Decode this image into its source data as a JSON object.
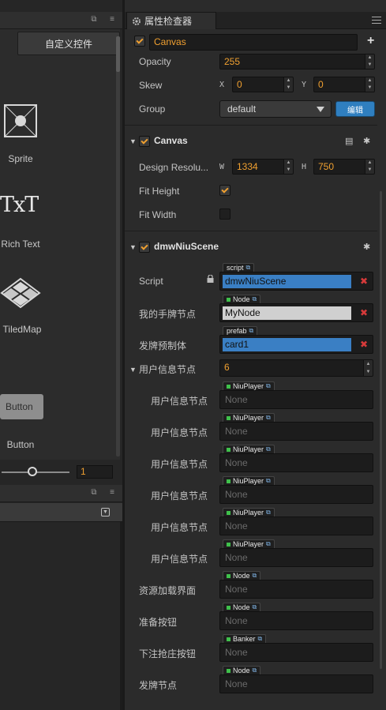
{
  "left_panel": {
    "custom_widgets_btn": "自定义控件",
    "widgets": [
      {
        "label": "Sprite",
        "icon": "sprite-icon"
      },
      {
        "label": "Rich Text",
        "icon": "richtext-icon"
      },
      {
        "label": "TiledMap",
        "icon": "tiledmap-icon"
      },
      {
        "label": "Button",
        "icon": "button-icon"
      }
    ],
    "richtext_glyph": "TxT",
    "button_preview_label": "Button",
    "zoom_value": "1",
    "zoom_level": 0.45
  },
  "inspector": {
    "tab_title": "属性检查器",
    "node": {
      "enabled": true,
      "name": "Canvas",
      "opacity_label": "Opacity",
      "opacity": "255",
      "skew_label": "Skew",
      "skew_x_axis": "X",
      "skew_x": "0",
      "skew_y_axis": "Y",
      "skew_y": "0",
      "group_label": "Group",
      "group_value": "default",
      "edit_button": "编辑"
    },
    "canvas_component": {
      "enabled": true,
      "title": "Canvas",
      "design_res_label": "Design Resolu...",
      "w_axis": "W",
      "width": "1334",
      "h_axis": "H",
      "height": "750",
      "fit_height_label": "Fit Height",
      "fit_height": true,
      "fit_width_label": "Fit Width",
      "fit_width": false
    },
    "script_component": {
      "enabled": true,
      "title": "dmwNiuScene",
      "fields": [
        {
          "label": "Script",
          "tag": "script",
          "value": "dmwNiuScene",
          "style": "blue"
        },
        {
          "label": "我的手牌节点",
          "tag": "Node",
          "value": "MyNode",
          "style": "grey"
        },
        {
          "label": "发牌预制体",
          "tag": "prefab",
          "value": "card1",
          "style": "blue"
        }
      ],
      "array_label": "用户信息节点",
      "array_size": "6",
      "array_items": [
        {
          "label": "用户信息节点",
          "tag": "NiuPlayer",
          "value": "None"
        },
        {
          "label": "用户信息节点",
          "tag": "NiuPlayer",
          "value": "None"
        },
        {
          "label": "用户信息节点",
          "tag": "NiuPlayer",
          "value": "None"
        },
        {
          "label": "用户信息节点",
          "tag": "NiuPlayer",
          "value": "None"
        },
        {
          "label": "用户信息节点",
          "tag": "NiuPlayer",
          "value": "None"
        },
        {
          "label": "用户信息节点",
          "tag": "NiuPlayer",
          "value": "None"
        }
      ],
      "extra_fields": [
        {
          "label": "资源加载界面",
          "tag": "Node",
          "value": "None"
        },
        {
          "label": "准备按钮",
          "tag": "Node",
          "value": "None"
        },
        {
          "label": "下注抢庄按钮",
          "tag": "Banker",
          "value": "None"
        },
        {
          "label": "发牌节点",
          "tag": "Node",
          "value": "None"
        }
      ]
    }
  },
  "colors": {
    "accent": "#f0a030",
    "selection": "#3a7fc4",
    "remove": "#d63a3a",
    "edit_button": "#2f7fc0"
  }
}
